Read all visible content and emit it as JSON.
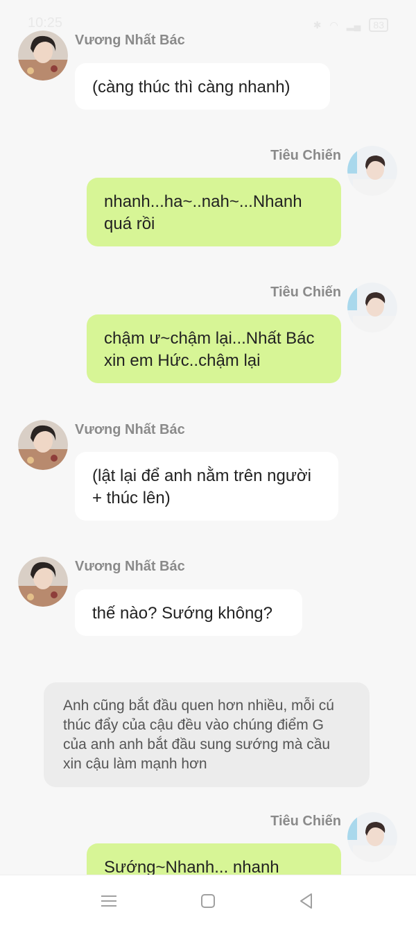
{
  "status_bar": {
    "time": "10:25",
    "battery": "83"
  },
  "messages": [
    {
      "sender": "Vương Nhất Bác",
      "side": "left",
      "text": "(càng thúc thì càng nhanh)"
    },
    {
      "sender": "Tiêu Chiến",
      "side": "right",
      "text": "nhanh...ha~..nah~...Nhanh quá rồi"
    },
    {
      "sender": "Tiêu Chiến",
      "side": "right",
      "text": "chậm ư~chậm lại...Nhất Bác xin em Hức..chậm lại"
    },
    {
      "sender": "Vương Nhất Bác",
      "side": "left",
      "text": "(lật lại để anh nằm trên người + thúc lên)"
    },
    {
      "sender": "Vương Nhất Bác",
      "side": "left",
      "text": "thế nào? Sướng không?"
    },
    {
      "sender": "Tiêu Chiến",
      "side": "right",
      "text": "Sướng~Nhanh... nhanh"
    }
  ],
  "narration": "Anh cũng bắt đầu quen hơn nhiều, mỗi cú thúc đẩy của cậu đều vào chúng điểm G của anh anh bắt đầu sung sướng mà cầu xin cậu làm mạnh hơn",
  "nav_bar": {
    "icons": [
      "menu-icon",
      "home-square-icon",
      "back-triangle-icon"
    ]
  }
}
